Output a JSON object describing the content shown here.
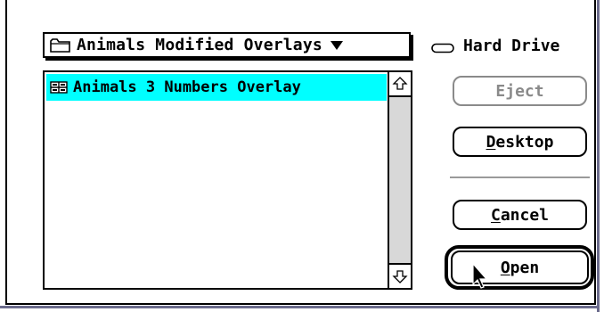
{
  "popup": {
    "icon": "folder-icon",
    "label": "Animals Modified Overlays",
    "arrow": "triangle-down-icon"
  },
  "volume": {
    "icon": "hard-drive-icon",
    "label": "Hard Drive"
  },
  "file_list": {
    "items": [
      {
        "icon": "document-icon",
        "label": "Animals 3 Numbers Overlay",
        "selected": true
      }
    ],
    "scroll_up_icon": "scroll-up-arrow-icon",
    "scroll_down_icon": "scroll-down-arrow-icon"
  },
  "buttons": {
    "eject": {
      "label": "Eject",
      "enabled": false
    },
    "desktop": {
      "label": "esktop",
      "mnemonic": "D"
    },
    "cancel": {
      "label": "ancel",
      "mnemonic": "C"
    },
    "open": {
      "label": "pen",
      "mnemonic": "O",
      "default": true
    }
  },
  "colors": {
    "selection": "#00ffff",
    "disabled": "#8a8a8a",
    "frame": "#6b6b8c"
  },
  "cursor": "arrow-pointer-icon"
}
